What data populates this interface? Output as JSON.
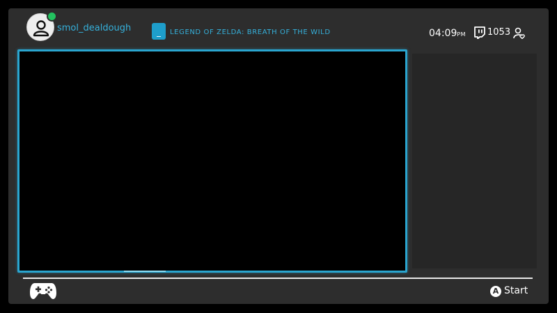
{
  "header": {
    "username": "smol_dealdough",
    "game_title": "LEGEND OF ZELDA: BREATH OF THE WILD",
    "time": "04:09",
    "time_suffix": "PM",
    "viewer_count": "1053"
  },
  "footer": {
    "a_button_glyph": "A",
    "start_label": "Start"
  },
  "icons": {
    "avatar": "user-avatar-icon",
    "status": "online-status-icon",
    "game": "game-card-icon",
    "twitch": "twitch-icon",
    "followers": "user-heart-icon",
    "controller": "gamepad-icon"
  },
  "colors": {
    "accent": "#2aa5cf",
    "text_accent": "#35b1dc",
    "online": "#23c25f",
    "background": "#2d2d2d"
  }
}
